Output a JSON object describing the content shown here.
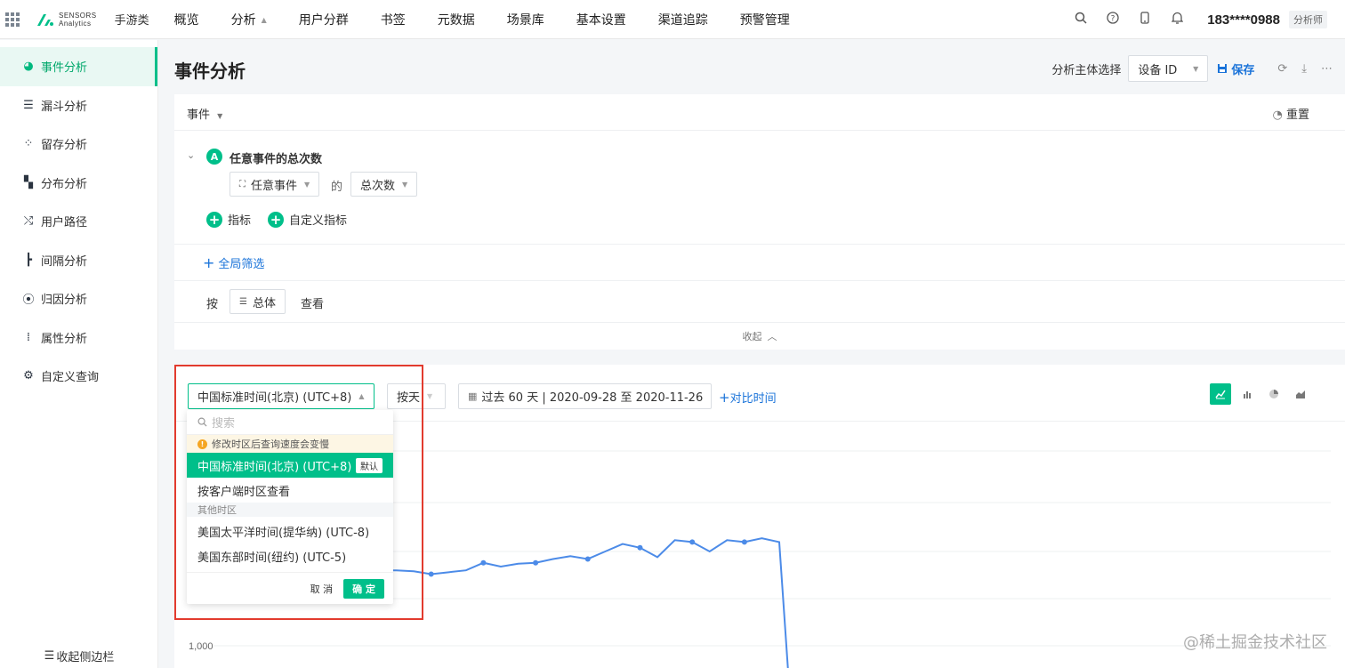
{
  "topnav": {
    "logo_line1": "SENSORS",
    "logo_line2": "Analytics",
    "project": "手游类",
    "items": [
      {
        "label": "概览",
        "caret": false
      },
      {
        "label": "分析",
        "caret": true
      },
      {
        "label": "用户分群",
        "caret": false
      },
      {
        "label": "书签",
        "caret": false
      },
      {
        "label": "元数据",
        "caret": false
      },
      {
        "label": "场景库",
        "caret": false
      },
      {
        "label": "基本设置",
        "caret": false
      },
      {
        "label": "渠道追踪",
        "caret": false
      },
      {
        "label": "预警管理",
        "caret": false
      }
    ],
    "user": "183****0988",
    "role": "分析师"
  },
  "sidebar": {
    "items": [
      {
        "label": "事件分析",
        "icon": "event-analysis-icon",
        "active": true
      },
      {
        "label": "漏斗分析",
        "icon": "funnel-icon",
        "active": false
      },
      {
        "label": "留存分析",
        "icon": "retention-icon",
        "active": false
      },
      {
        "label": "分布分析",
        "icon": "distribution-icon",
        "active": false
      },
      {
        "label": "用户路径",
        "icon": "user-path-icon",
        "active": false
      },
      {
        "label": "间隔分析",
        "icon": "interval-icon",
        "active": false
      },
      {
        "label": "归因分析",
        "icon": "attribution-icon",
        "active": false
      },
      {
        "label": "属性分析",
        "icon": "property-icon",
        "active": false
      },
      {
        "label": "自定义查询",
        "icon": "custom-query-icon",
        "active": false
      }
    ],
    "collapse_label": "收起侧边栏"
  },
  "header": {
    "title": "事件分析",
    "subject_label": "分析主体选择",
    "subject_value": "设备 ID",
    "save_label": "保存"
  },
  "query": {
    "event_label": "事件",
    "reset_label": "重置",
    "metric_letter": "A",
    "metric_title": "任意事件的总次数",
    "event_select": "任意事件",
    "of_label": "的",
    "measure_select": "总次数",
    "add_metric": "指标",
    "add_custom_metric": "自定义指标",
    "global_filter": "全局筛选",
    "by_label": "按",
    "group_select": "总体",
    "view_label": "查看",
    "collapse_label": "收起"
  },
  "toolbar": {
    "timezone": "中国标准时间(北京) (UTC+8)",
    "granularity": "按天",
    "date_range": "过去 60 天 | 2020-09-28 至 2020-11-26",
    "compare_label": "对比时间"
  },
  "dropdown": {
    "search_placeholder": "搜索",
    "warning": "修改时区后查询速度会变慢",
    "selected": "中国标准时间(北京) (UTC+8)",
    "default_badge": "默认",
    "client_tz": "按客户端时区查看",
    "group_label": "其他时区",
    "others": [
      "美国太平洋时间(提华纳) (UTC-8)",
      "美国东部时间(纽约) (UTC-5)"
    ],
    "cancel": "取 消",
    "ok": "确 定"
  },
  "chart_data": {
    "type": "line",
    "title": "",
    "y_tick_visible": "1,000",
    "series": [
      {
        "name": "",
        "values": [
          1400,
          1400,
          1395,
          1380,
          1390,
          1400,
          1440,
          1420,
          1435,
          1440,
          1460,
          1475,
          1460,
          1500,
          1540,
          1520,
          1470,
          1560,
          1550,
          1500,
          1560,
          1550,
          1570,
          1550,
          500
        ]
      }
    ],
    "color": "#4c8be8"
  },
  "watermark": "@稀土掘金技术社区",
  "colors": {
    "accent": "#00bf8a",
    "link": "#1a73d9",
    "highlight": "#e23b2e"
  }
}
